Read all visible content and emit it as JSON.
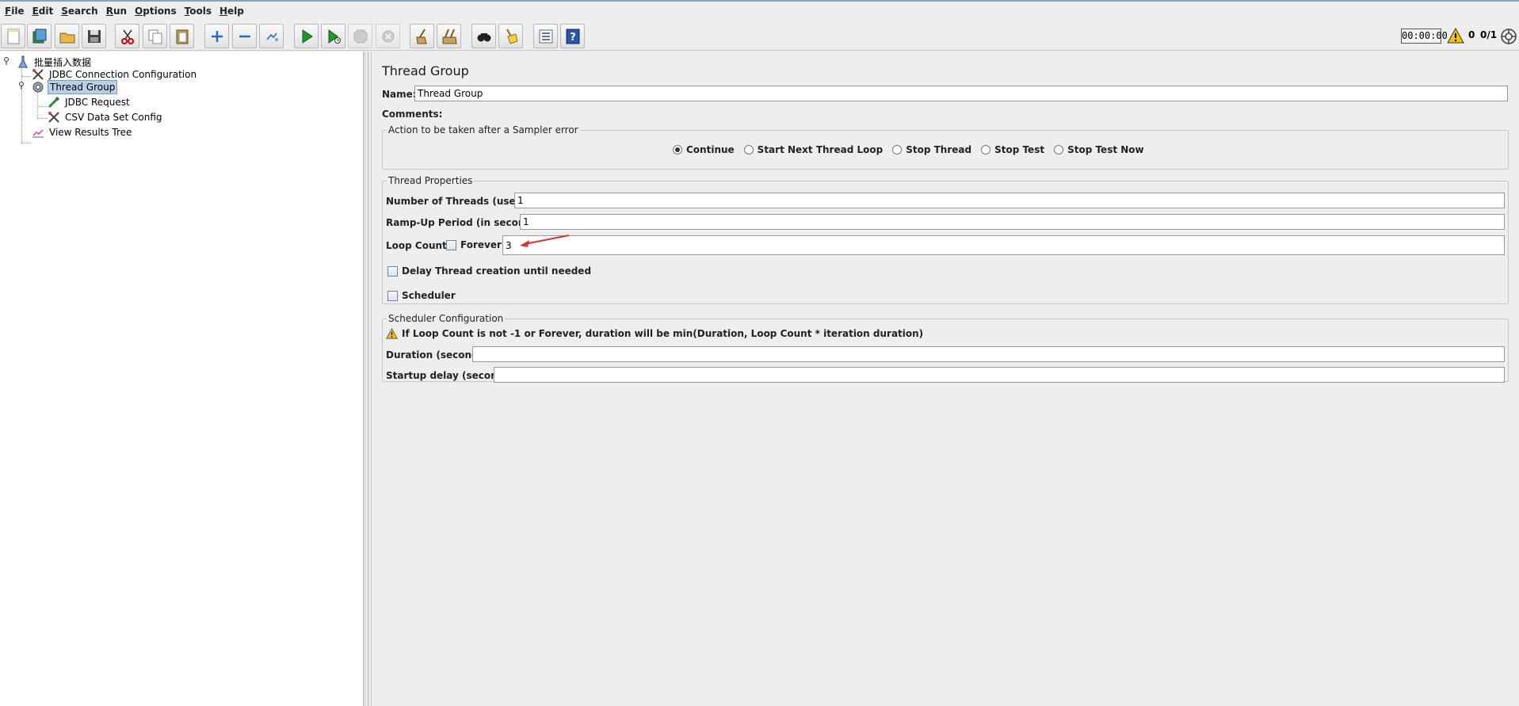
{
  "menu": [
    {
      "u": "F",
      "rest": "ile"
    },
    {
      "u": "E",
      "rest": "dit"
    },
    {
      "u": "S",
      "rest": "earch"
    },
    {
      "u": "R",
      "rest": "un"
    },
    {
      "u": "O",
      "rest": "ptions"
    },
    {
      "u": "T",
      "rest": "ools"
    },
    {
      "u": "H",
      "rest": "elp"
    }
  ],
  "toolbar": {
    "icons": [
      "new-icon",
      "templates-icon",
      "open-icon",
      "save-icon",
      "cut-icon",
      "copy-icon",
      "paste-icon",
      "expand-icon",
      "collapse-icon",
      "toggle-icon",
      "start-icon",
      "start-no-pause-icon",
      "stop-icon",
      "shutdown-icon",
      "clear-icon",
      "clear-all-icon",
      "search-icon",
      "reset-search-icon",
      "function-helper-icon",
      "help-icon"
    ],
    "timer": "00:00:00",
    "error_count": "0",
    "threads": "0/1"
  },
  "tree": {
    "root": "批量插入数据",
    "items": [
      {
        "label": "JDBC Connection Configuration",
        "icon": "wrench-icon"
      },
      {
        "label": "Thread Group",
        "icon": "gear-icon"
      },
      {
        "label": "JDBC Request",
        "icon": "pipette-icon"
      },
      {
        "label": "CSV Data Set Config",
        "icon": "wrench-icon"
      },
      {
        "label": "View Results Tree",
        "icon": "chart-icon"
      }
    ]
  },
  "panel": {
    "title": "Thread Group",
    "name_label": "Name:",
    "name_value": "Thread Group",
    "comments_label": "Comments:",
    "comments_value": "",
    "sampler_error": {
      "title": "Action to be taken after a Sampler error",
      "options": [
        "Continue",
        "Start Next Thread Loop",
        "Stop Thread",
        "Stop Test",
        "Stop Test Now"
      ],
      "selected": "Continue"
    },
    "thread_props": {
      "title": "Thread Properties",
      "threads_label": "Number of Threads (users):",
      "threads_value": "1",
      "rampup_label": "Ramp-Up Period (in seconds):",
      "rampup_value": "1",
      "loop_label": "Loop Count:",
      "forever_label": "Forever",
      "loop_value": "3",
      "delay_label": "Delay Thread creation until needed",
      "scheduler_label": "Scheduler"
    },
    "scheduler_config": {
      "title": "Scheduler Configuration",
      "warning": "If Loop Count is not -1 or Forever, duration will be min(Duration, Loop Count * iteration duration)",
      "duration_label": "Duration (seconds)",
      "duration_value": "",
      "startup_label": "Startup delay (seconds)",
      "startup_value": ""
    }
  },
  "colors": {
    "selection": "#b8cfe5",
    "annotation_arrow": "#e0302a",
    "warning": "#f2c200"
  }
}
